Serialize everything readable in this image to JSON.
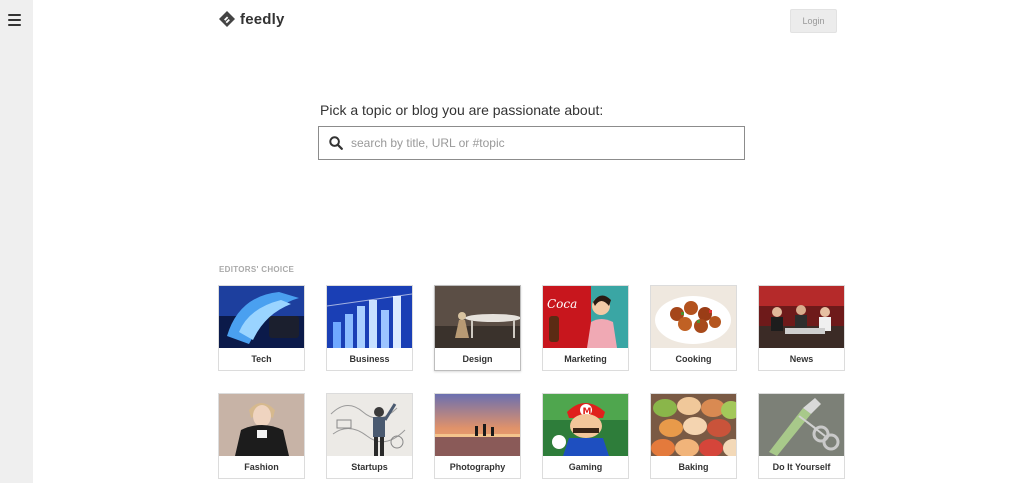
{
  "header": {
    "logo_text": "feedly",
    "login_label": "Login"
  },
  "main": {
    "prompt": "Pick a topic or blog you are passionate about:",
    "search_placeholder": "search by title, URL or #topic"
  },
  "editors_choice": {
    "title": "EDITORS' CHOICE",
    "topics": [
      {
        "label": "Tech"
      },
      {
        "label": "Business"
      },
      {
        "label": "Design"
      },
      {
        "label": "Marketing"
      },
      {
        "label": "Cooking"
      },
      {
        "label": "News"
      },
      {
        "label": "Fashion"
      },
      {
        "label": "Startups"
      },
      {
        "label": "Photography"
      },
      {
        "label": "Gaming"
      },
      {
        "label": "Baking"
      },
      {
        "label": "Do It Yourself"
      }
    ]
  },
  "colors": {
    "sidebar_bg": "#efefef",
    "search_border": "#8c8c8c",
    "section_title": "#aaaaaa"
  }
}
